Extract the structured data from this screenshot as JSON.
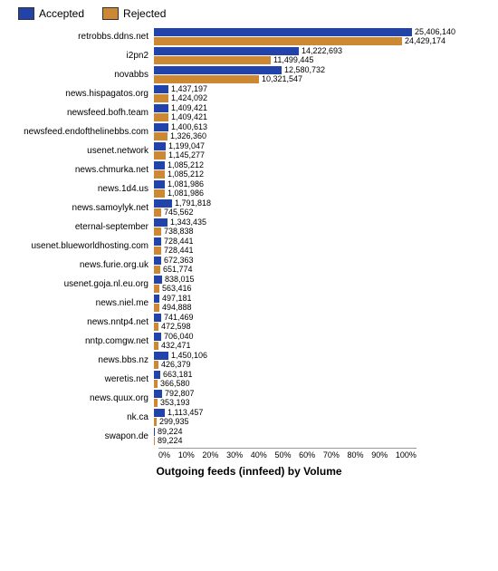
{
  "legend": {
    "accepted_label": "Accepted",
    "rejected_label": "Rejected",
    "accepted_color": "#2244aa",
    "rejected_color": "#cc8833"
  },
  "chart_title": "Outgoing feeds (innfeed) by Volume",
  "x_axis_labels": [
    "0%",
    "10%",
    "20%",
    "30%",
    "40%",
    "50%",
    "60%",
    "70%",
    "80%",
    "90%",
    "100%"
  ],
  "max_value": 25406140,
  "bars": [
    {
      "label": "retrobbs.ddns.net",
      "accepted": 25406140,
      "rejected": 24429174
    },
    {
      "label": "i2pn2",
      "accepted": 14222693,
      "rejected": 11499445
    },
    {
      "label": "novabbs",
      "accepted": 12580732,
      "rejected": 10321547
    },
    {
      "label": "news.hispagatos.org",
      "accepted": 1437197,
      "rejected": 1424092
    },
    {
      "label": "newsfeed.bofh.team",
      "accepted": 1409421,
      "rejected": 1409421
    },
    {
      "label": "newsfeed.endofthelinebbs.com",
      "accepted": 1400613,
      "rejected": 1326360
    },
    {
      "label": "usenet.network",
      "accepted": 1199047,
      "rejected": 1145277
    },
    {
      "label": "news.chmurka.net",
      "accepted": 1085212,
      "rejected": 1085212
    },
    {
      "label": "news.1d4.us",
      "accepted": 1081986,
      "rejected": 1081986
    },
    {
      "label": "news.samoylyk.net",
      "accepted": 1791818,
      "rejected": 745562
    },
    {
      "label": "eternal-september",
      "accepted": 1343435,
      "rejected": 738838
    },
    {
      "label": "usenet.blueworldhosting.com",
      "accepted": 728441,
      "rejected": 728441
    },
    {
      "label": "news.furie.org.uk",
      "accepted": 672363,
      "rejected": 651774
    },
    {
      "label": "usenet.goja.nl.eu.org",
      "accepted": 838015,
      "rejected": 563416
    },
    {
      "label": "news.niel.me",
      "accepted": 497181,
      "rejected": 494888
    },
    {
      "label": "news.nntp4.net",
      "accepted": 741469,
      "rejected": 472598
    },
    {
      "label": "nntp.comgw.net",
      "accepted": 706040,
      "rejected": 432471
    },
    {
      "label": "news.bbs.nz",
      "accepted": 1450106,
      "rejected": 426379
    },
    {
      "label": "weretis.net",
      "accepted": 663181,
      "rejected": 366580
    },
    {
      "label": "news.quux.org",
      "accepted": 792807,
      "rejected": 353193
    },
    {
      "label": "nk.ca",
      "accepted": 1113457,
      "rejected": 299935
    },
    {
      "label": "swapon.de",
      "accepted": 89224,
      "rejected": 89224
    }
  ]
}
